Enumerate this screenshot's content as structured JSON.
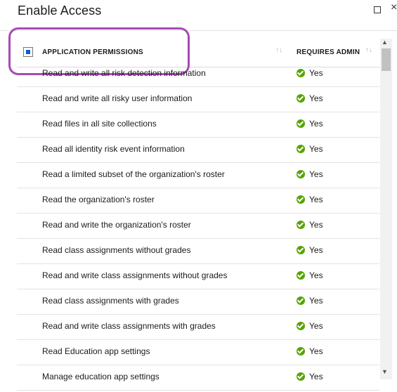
{
  "window": {
    "title": "Enable Access",
    "maximize_icon": "maximize-icon",
    "close_icon": "close-icon"
  },
  "header": {
    "select_all_state": "indeterminate",
    "col_permissions": "APPLICATION PERMISSIONS",
    "col_requires_admin": "REQUIRES ADMIN",
    "sort_glyph": "↑↓"
  },
  "rows": [
    {
      "permission": "Read and write all risk detection information",
      "requires_admin": "Yes"
    },
    {
      "permission": "Read and write all risky user information",
      "requires_admin": "Yes"
    },
    {
      "permission": "Read files in all site collections",
      "requires_admin": "Yes"
    },
    {
      "permission": "Read all identity risk event information",
      "requires_admin": "Yes"
    },
    {
      "permission": "Read a limited subset of the organization's roster",
      "requires_admin": "Yes"
    },
    {
      "permission": "Read the organization's roster",
      "requires_admin": "Yes"
    },
    {
      "permission": "Read and write the organization's roster",
      "requires_admin": "Yes"
    },
    {
      "permission": "Read class assignments without grades",
      "requires_admin": "Yes"
    },
    {
      "permission": "Read and write class assignments without grades",
      "requires_admin": "Yes"
    },
    {
      "permission": "Read class assignments with grades",
      "requires_admin": "Yes"
    },
    {
      "permission": "Read and write class assignments with grades",
      "requires_admin": "Yes"
    },
    {
      "permission": "Read Education app settings",
      "requires_admin": "Yes"
    },
    {
      "permission": "Manage education app settings",
      "requires_admin": "Yes"
    }
  ],
  "colors": {
    "highlight": "#a849b5",
    "check_green": "#57a300",
    "checkbox_blue": "#0b5cd7"
  }
}
